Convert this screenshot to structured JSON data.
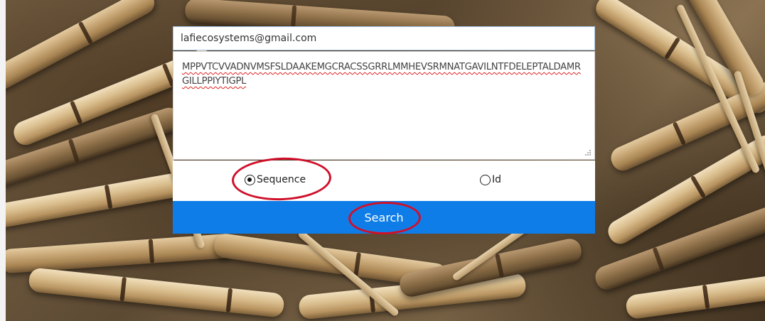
{
  "form": {
    "email_value": "lafiecosystems@gmail.com",
    "sequence_value": "MPPVTCVVADNVMSFSLDAAKEMGCRACSSGRRLMMHEVSRMNATGAVILNTFDELEPTALDAMRGILLPPIYTIGPL",
    "radio_options": [
      {
        "label": "Sequence",
        "checked": true
      },
      {
        "label": "Id",
        "checked": false
      }
    ],
    "search_label": "Search"
  },
  "colors": {
    "button_bg": "#0f7de8",
    "annotation": "#d0102a",
    "spellcheck_underline": "#e02020"
  }
}
